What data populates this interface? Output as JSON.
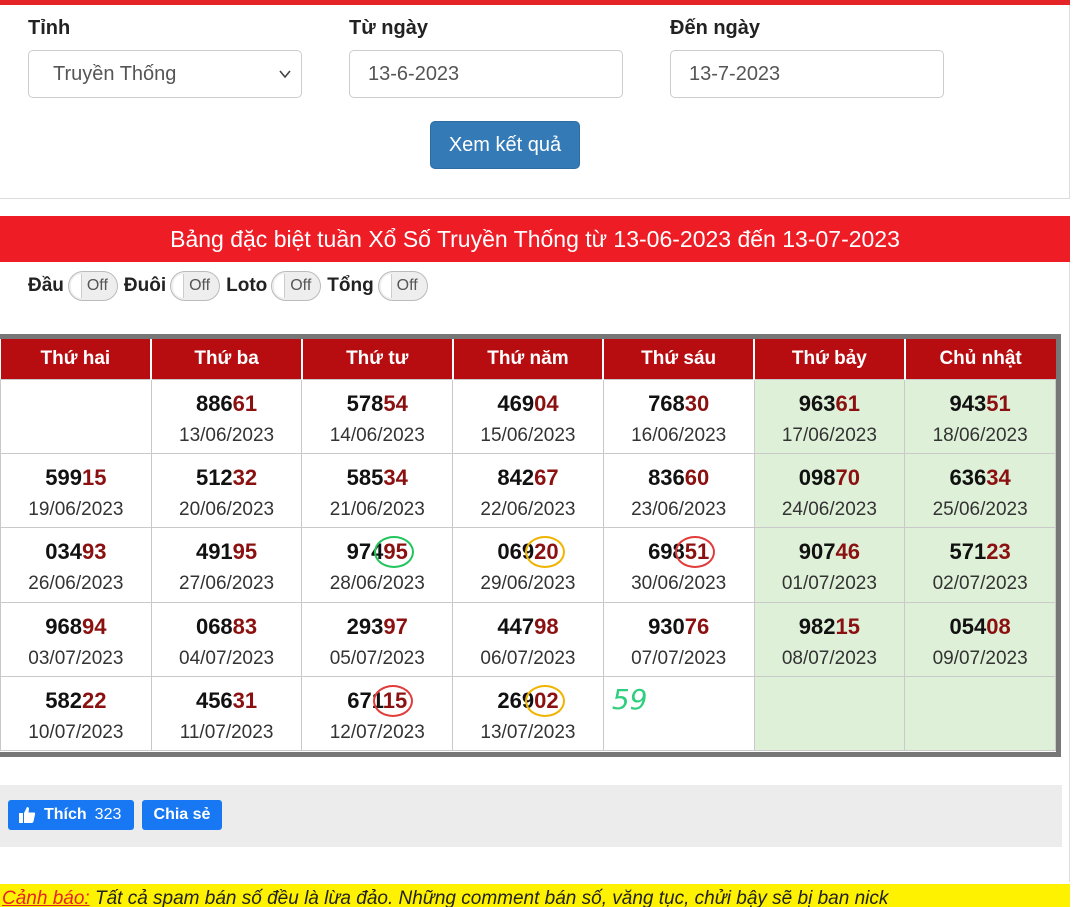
{
  "form": {
    "province_label": "Tỉnh",
    "province_value": "Truyền Thống",
    "from_label": "Từ ngày",
    "from_value": "13-6-2023",
    "to_label": "Đến ngày",
    "to_value": "13-7-2023",
    "submit_label": "Xem kết quả"
  },
  "title": "Bảng đặc biệt tuần Xổ Số Truyền Thống từ 13-06-2023 đến 13-07-2023",
  "toggles": [
    {
      "label": "Đầu",
      "state": "Off"
    },
    {
      "label": "Đuôi",
      "state": "Off"
    },
    {
      "label": "Loto",
      "state": "Off"
    },
    {
      "label": "Tổng",
      "state": "Off"
    }
  ],
  "headers": [
    "Thứ hai",
    "Thứ ba",
    "Thứ tư",
    "Thứ năm",
    "Thứ sáu",
    "Thứ bảy",
    "Chủ nhật"
  ],
  "rows": [
    [
      null,
      {
        "head": "886",
        "tail": "61",
        "date": "13/06/2023"
      },
      {
        "head": "578",
        "tail": "54",
        "date": "14/06/2023"
      },
      {
        "head": "469",
        "tail": "04",
        "date": "15/06/2023"
      },
      {
        "head": "768",
        "tail": "30",
        "date": "16/06/2023"
      },
      {
        "head": "963",
        "tail": "61",
        "date": "17/06/2023"
      },
      {
        "head": "943",
        "tail": "51",
        "date": "18/06/2023"
      }
    ],
    [
      {
        "head": "599",
        "tail": "15",
        "date": "19/06/2023"
      },
      {
        "head": "512",
        "tail": "32",
        "date": "20/06/2023"
      },
      {
        "head": "585",
        "tail": "34",
        "date": "21/06/2023"
      },
      {
        "head": "842",
        "tail": "67",
        "date": "22/06/2023"
      },
      {
        "head": "836",
        "tail": "60",
        "date": "23/06/2023"
      },
      {
        "head": "098",
        "tail": "70",
        "date": "24/06/2023"
      },
      {
        "head": "636",
        "tail": "34",
        "date": "25/06/2023"
      }
    ],
    [
      {
        "head": "034",
        "tail": "93",
        "date": "26/06/2023"
      },
      {
        "head": "491",
        "tail": "95",
        "date": "27/06/2023"
      },
      {
        "head": "974",
        "tail": "95",
        "date": "28/06/2023",
        "circle": "green"
      },
      {
        "head": "069",
        "tail": "20",
        "date": "29/06/2023",
        "circle": "yellow"
      },
      {
        "head": "698",
        "tail": "51",
        "date": "30/06/2023",
        "circle": "red"
      },
      {
        "head": "907",
        "tail": "46",
        "date": "01/07/2023"
      },
      {
        "head": "571",
        "tail": "23",
        "date": "02/07/2023"
      }
    ],
    [
      {
        "head": "968",
        "tail": "94",
        "date": "03/07/2023"
      },
      {
        "head": "068",
        "tail": "83",
        "date": "04/07/2023"
      },
      {
        "head": "293",
        "tail": "97",
        "date": "05/07/2023"
      },
      {
        "head": "447",
        "tail": "98",
        "date": "06/07/2023"
      },
      {
        "head": "930",
        "tail": "76",
        "date": "07/07/2023"
      },
      {
        "head": "982",
        "tail": "15",
        "date": "08/07/2023"
      },
      {
        "head": "054",
        "tail": "08",
        "date": "09/07/2023"
      }
    ],
    [
      {
        "head": "582",
        "tail": "22",
        "date": "10/07/2023"
      },
      {
        "head": "456",
        "tail": "31",
        "date": "11/07/2023"
      },
      {
        "head": "671",
        "tail": "15",
        "date": "12/07/2023",
        "circle": "red"
      },
      {
        "head": "269",
        "tail": "02",
        "date": "13/07/2023",
        "circle": "yellow"
      },
      {
        "scribble": "59"
      },
      null,
      null
    ]
  ],
  "social": {
    "like_label": "Thích",
    "like_count": "323",
    "share_label": "Chia sẻ"
  },
  "warning": {
    "lead": "Cảnh báo:",
    "text": " Tất cả spam bán số đều là lừa đảo. Những comment bán số, văng tục, chửi bậy sẽ bị ban nick"
  },
  "colors": {
    "accent_red": "#ee1c25",
    "header_red": "#b70c10",
    "weekend_green": "#dff0d8",
    "button_blue": "#337ab7",
    "facebook_blue": "#1877f2",
    "warning_yellow": "#fff200"
  }
}
